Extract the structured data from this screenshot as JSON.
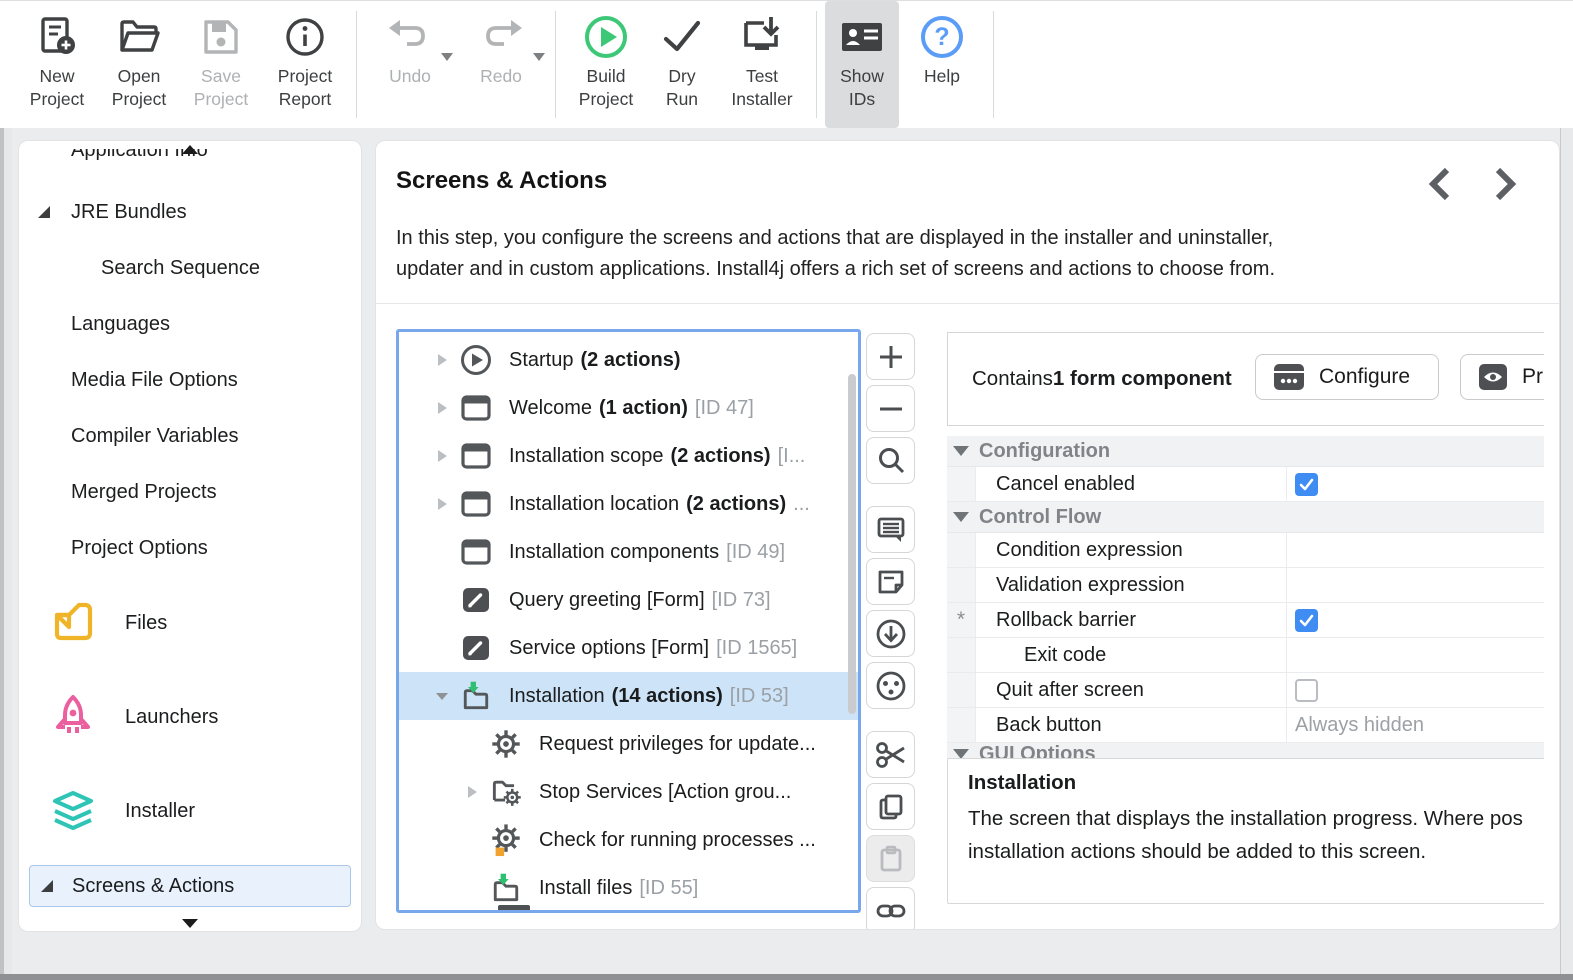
{
  "colors": {
    "accent_blue": "#3f8cf3",
    "selection_blue": "#cde4f8",
    "tree_border_blue": "#79a7ec",
    "sidebar_selected_bg": "#e9f2fc",
    "build_green": "#3dc878",
    "install_arrow_green": "#2fbf71",
    "help_blue": "#5a9cf8",
    "files_orange": "#f0b429",
    "launchers_pink": "#ec5f9e",
    "installer_teal": "#2ec4b6",
    "badge_orange": "#f0a32e"
  },
  "toolbar": {
    "groups": [
      {
        "items": [
          {
            "name": "new-project",
            "label": "New\nProject",
            "icon": "document-plus-icon"
          },
          {
            "name": "open-project",
            "label": "Open\nProject",
            "icon": "folder-open-icon"
          },
          {
            "name": "save-project",
            "label": "Save\nProject",
            "icon": "floppy-disk-icon",
            "disabled": true
          },
          {
            "name": "project-report",
            "label": "Project\nReport",
            "icon": "info-circle-icon"
          }
        ]
      },
      {
        "items": [
          {
            "name": "undo",
            "label": "Undo",
            "icon": "undo-arrow-icon",
            "disabled": true,
            "dropdown": true
          },
          {
            "name": "redo",
            "label": "Redo",
            "icon": "redo-arrow-icon",
            "disabled": true,
            "dropdown": true
          }
        ]
      },
      {
        "items": [
          {
            "name": "build-project",
            "label": "Build\nProject",
            "icon": "play-circle-icon"
          },
          {
            "name": "dry-run",
            "label": "Dry\nRun",
            "icon": "checkmark-icon"
          },
          {
            "name": "test-installer",
            "label": "Test\nInstaller",
            "icon": "monitor-download-icon"
          }
        ]
      },
      {
        "items": [
          {
            "name": "show-ids",
            "label": "Show\nIDs",
            "icon": "id-card-icon",
            "active": true
          },
          {
            "name": "help",
            "label": "Help",
            "icon": "question-circle-icon"
          }
        ]
      }
    ]
  },
  "sidebar": {
    "scroll_up": "scroll-up-arrow",
    "scroll_down": "scroll-down-arrow",
    "clipped_top_item": "Application Info",
    "items": [
      {
        "label": "JRE Bundles",
        "expanded": true
      },
      {
        "label": "Search Sequence",
        "indent": 2
      },
      {
        "label": "Languages"
      },
      {
        "label": "Media File Options"
      },
      {
        "label": "Compiler Variables"
      },
      {
        "label": "Merged Projects"
      },
      {
        "label": "Project Options"
      },
      {
        "label": "Files",
        "icon": "files-icon"
      },
      {
        "label": "Launchers",
        "icon": "rocket-icon"
      },
      {
        "label": "Installer",
        "icon": "layers-icon"
      },
      {
        "label": "Screens & Actions",
        "expanded": true,
        "selected": true
      }
    ]
  },
  "main": {
    "title": "Screens & Actions",
    "desc_line1": "In this step, you configure the screens and actions that are displayed in the installer and uninstaller,",
    "desc_line2": "updater and in custom applications. Install4j offers a rich set of screens and actions to choose from.",
    "nav": {
      "prev": "chevron-left",
      "next": "chevron-right"
    }
  },
  "tree": {
    "items": [
      {
        "label": "Startup",
        "actions": "(2 actions)",
        "id": "",
        "icon": "startup-play-icon",
        "expander": "collapsed",
        "level": 1
      },
      {
        "label": "Welcome",
        "actions": "(1 action)",
        "id": "[ID 47]",
        "icon": "screen-icon",
        "expander": "collapsed",
        "level": 1
      },
      {
        "label": "Installation scope",
        "actions": "(2 actions)",
        "id": "[I...",
        "icon": "screen-icon",
        "expander": "collapsed",
        "level": 1
      },
      {
        "label": "Installation location",
        "actions": "(2 actions)",
        "id": "...",
        "icon": "screen-icon",
        "expander": "collapsed",
        "level": 1
      },
      {
        "label": "Installation components",
        "actions": "",
        "id": "[ID 49]",
        "icon": "screen-icon",
        "expander": "none",
        "level": 1
      },
      {
        "label": "Query greeting [Form]",
        "actions": "",
        "id": "[ID 73]",
        "icon": "form-pencil-icon",
        "expander": "none",
        "level": 1
      },
      {
        "label": "Service options [Form]",
        "actions": "",
        "id": "[ID 1565]",
        "icon": "form-pencil-icon",
        "expander": "none",
        "level": 1
      },
      {
        "label": "Installation",
        "actions": "(14 actions)",
        "id": "[ID 53]",
        "icon": "install-folder-icon",
        "expander": "expanded",
        "level": 1,
        "selected": true
      },
      {
        "label": "Request privileges for update...",
        "actions": "",
        "id": "",
        "icon": "gear-icon",
        "expander": "none",
        "level": 2
      },
      {
        "label": "Stop Services [Action grou...",
        "actions": "",
        "id": "",
        "icon": "action-group-icon",
        "expander": "collapsed",
        "level": 2
      },
      {
        "label": "Check for running processes ...",
        "actions": "",
        "id": "",
        "icon": "gear-badge-icon",
        "expander": "none",
        "level": 2
      },
      {
        "label": "Install files",
        "actions": "",
        "id": "[ID 55]",
        "icon": "install-folder-icon",
        "expander": "none",
        "level": 2
      }
    ]
  },
  "side_toolbar": {
    "buttons": [
      {
        "name": "add",
        "icon": "plus-icon"
      },
      {
        "name": "remove",
        "icon": "minus-icon"
      },
      {
        "name": "search",
        "icon": "magnifier-icon"
      },
      {
        "name": "comment",
        "icon": "speech-bubble-icon"
      },
      {
        "name": "edit-note",
        "icon": "note-icon"
      },
      {
        "name": "download-screen",
        "icon": "down-circle-icon"
      },
      {
        "name": "socket",
        "icon": "dots-circle-icon"
      },
      {
        "name": "cut",
        "icon": "scissors-icon"
      },
      {
        "name": "copy",
        "icon": "duplicate-icon"
      },
      {
        "name": "paste",
        "icon": "clipboard-icon",
        "disabled": true
      },
      {
        "name": "link",
        "icon": "link-icon"
      }
    ]
  },
  "panel": {
    "contains": {
      "prefix": "Contains ",
      "bold": "1 form component",
      "configure_label": "Configure",
      "preview_label": "Pr"
    },
    "properties": {
      "section1": "Configuration",
      "row_cancel": "Cancel enabled",
      "section2": "Control Flow",
      "row_condition": "Condition expression",
      "row_validation": "Validation expression",
      "row_rollback": "Rollback barrier",
      "row_rollback_gutter": "*",
      "row_exitcode": "Exit code",
      "row_quit": "Quit after screen",
      "row_back": "Back button",
      "row_back_value": "Always hidden",
      "section3": "GUI Options"
    },
    "description": {
      "title": "Installation",
      "line1": "The screen that displays the installation progress. Where pos",
      "line2": "installation actions should be added to this screen."
    }
  }
}
